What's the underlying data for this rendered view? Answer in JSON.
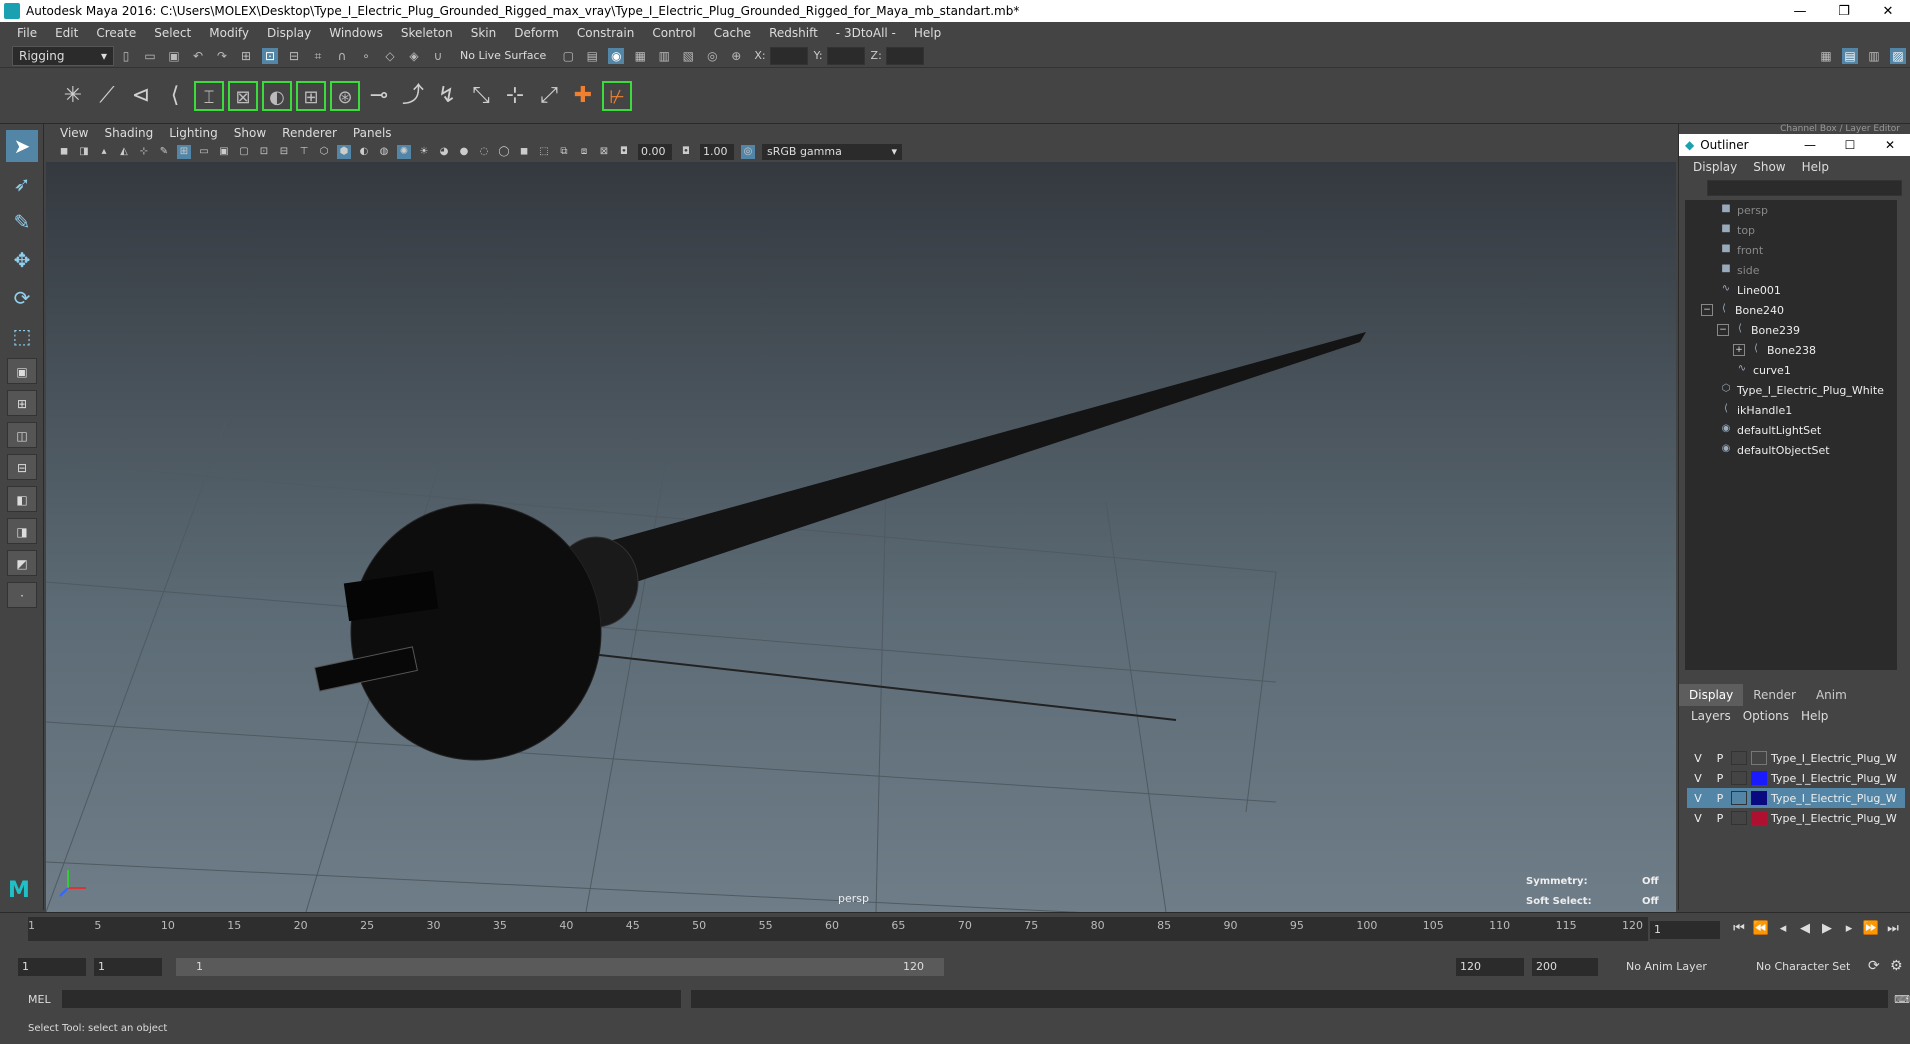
{
  "window": {
    "title": "Autodesk Maya 2016: C:\\Users\\MOLEX\\Desktop\\Type_I_Electric_Plug_Grounded_Rigged_max_vray\\Type_I_Electric_Plug_Grounded_Rigged_for_Maya_mb_standart.mb*",
    "minimize": "—",
    "restore": "❐",
    "close": "✕"
  },
  "menubar": [
    "File",
    "Edit",
    "Create",
    "Select",
    "Modify",
    "Display",
    "Windows",
    "Skeleton",
    "Skin",
    "Deform",
    "Constrain",
    "Control",
    "Cache",
    "Redshift",
    "- 3DtoAll -",
    "Help"
  ],
  "statusline": {
    "mode": "Rigging",
    "no_live_surface": "No Live Surface",
    "x_label": "X:",
    "y_label": "Y:",
    "z_label": "Z:"
  },
  "panel_menu": [
    "View",
    "Shading",
    "Lighting",
    "Show",
    "Renderer",
    "Panels"
  ],
  "panel_tools": {
    "exposure": "0.00",
    "gamma": "1.00",
    "color_space": "sRGB gamma"
  },
  "viewport": {
    "camera_label": "persp",
    "symmetry_label": "Symmetry:",
    "symmetry_value": "Off",
    "soft_select_label": "Soft Select:",
    "soft_select_value": "Off"
  },
  "outliner": {
    "title": "Outliner",
    "menu": [
      "Display",
      "Show",
      "Help"
    ],
    "channel_box_label": "Channel Box / Layer Editor",
    "items": [
      {
        "label": "persp",
        "dim": true,
        "icon": "camera-icon",
        "indent": 0
      },
      {
        "label": "top",
        "dim": true,
        "icon": "camera-icon",
        "indent": 0
      },
      {
        "label": "front",
        "dim": true,
        "icon": "camera-icon",
        "indent": 0
      },
      {
        "label": "side",
        "dim": true,
        "icon": "camera-icon",
        "indent": 0
      },
      {
        "label": "Line001",
        "dim": false,
        "icon": "curve-icon",
        "indent": 0
      },
      {
        "label": "Bone240",
        "dim": false,
        "icon": "joint-icon",
        "indent": 0
      },
      {
        "label": "Bone239",
        "dim": false,
        "icon": "joint-icon",
        "indent": 1
      },
      {
        "label": "Bone238",
        "dim": false,
        "icon": "joint-icon",
        "indent": 2
      },
      {
        "label": "curve1",
        "dim": false,
        "icon": "curve-icon",
        "indent": 1
      },
      {
        "label": "Type_I_Electric_Plug_White",
        "dim": false,
        "icon": "mesh-icon",
        "indent": 0
      },
      {
        "label": "ikHandle1",
        "dim": false,
        "icon": "ik-handle-icon",
        "indent": 0
      },
      {
        "label": "defaultLightSet",
        "dim": false,
        "icon": "set-icon",
        "indent": 0
      },
      {
        "label": "defaultObjectSet",
        "dim": false,
        "icon": "set-icon",
        "indent": 0
      }
    ]
  },
  "layer_editor": {
    "tabs": [
      "Display",
      "Render",
      "Anim"
    ],
    "menu": [
      "Layers",
      "Options",
      "Help"
    ],
    "layers": [
      {
        "v": "V",
        "p": "P",
        "label": "Type_I_Electric_Plug_W",
        "color": "",
        "selected": false
      },
      {
        "v": "V",
        "p": "P",
        "label": "Type_I_Electric_Plug_W",
        "color": "#1a1aff",
        "selected": false
      },
      {
        "v": "V",
        "p": "P",
        "label": "Type_I_Electric_Plug_W",
        "color": "#0a0a80",
        "selected": true
      },
      {
        "v": "V",
        "p": "P",
        "label": "Type_I_Electric_Plug_W",
        "color": "#b01030",
        "selected": false
      }
    ]
  },
  "timeline": {
    "ticks": [
      "1",
      "5",
      "10",
      "15",
      "20",
      "25",
      "30",
      "35",
      "40",
      "45",
      "50",
      "55",
      "60",
      "65",
      "70",
      "75",
      "80",
      "85",
      "90",
      "95",
      "100",
      "105",
      "110",
      "115",
      "120"
    ],
    "current_frame": "1"
  },
  "range": {
    "start": "1",
    "inner_start": "1",
    "bar_start": "1",
    "bar_end": "120",
    "end": "120",
    "anim_end": "200",
    "anim_layer": "No Anim Layer",
    "char_set": "No Character Set"
  },
  "command_line": {
    "mel": "MEL"
  },
  "help_line": "Select Tool: select an object"
}
